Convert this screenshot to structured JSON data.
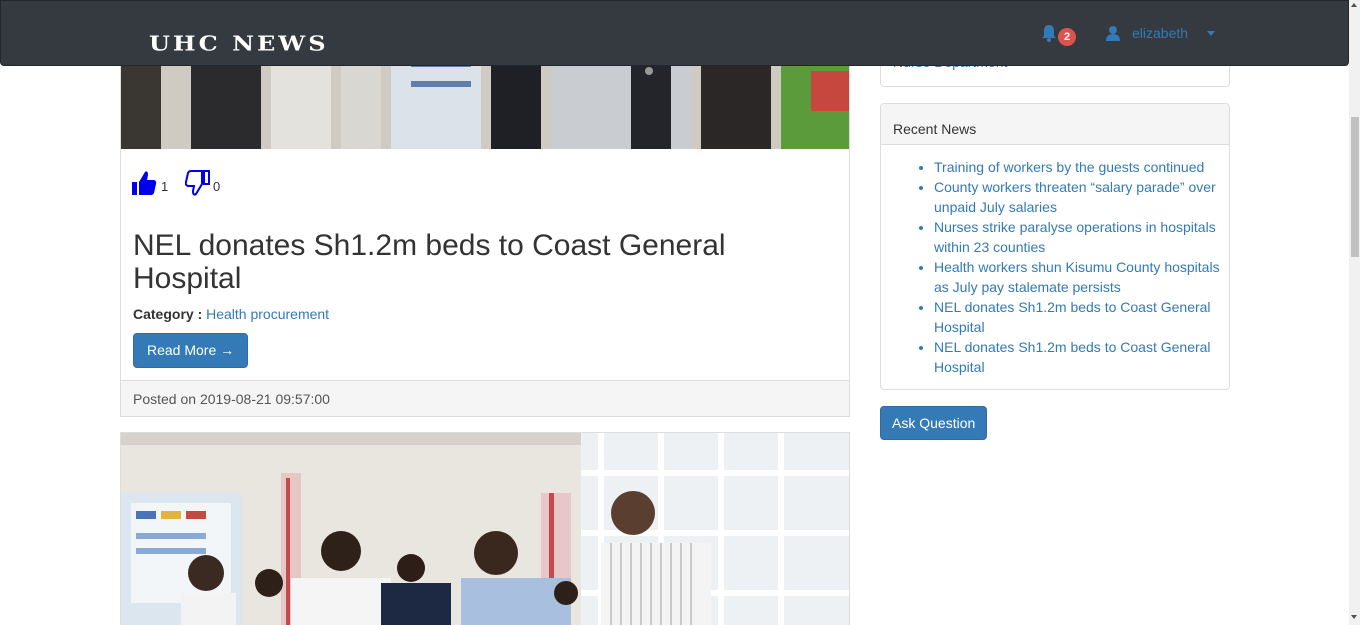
{
  "navbar": {
    "brand": "UHC NEWS",
    "notification_count": "2",
    "username": "elizabeth"
  },
  "posts": [
    {
      "likes": "1",
      "dislikes": "0",
      "title": "NEL donates Sh1.2m beds to Coast General Hospital",
      "category_label": "Category :",
      "category": "Health procurement",
      "read_more_label": "Read More →",
      "posted_on": "Posted on 2019-08-21 09:57:00"
    }
  ],
  "sidebar": {
    "department_link": "Nurse Department",
    "recent_news_title": "Recent News",
    "recent_news": [
      "Training of workers by the guests continued",
      "County workers threaten “salary parade” over unpaid July salaries",
      "Nurses strike paralyse operations in hospitals within 23 counties",
      "Health workers shun Kisumu County hospitals as July pay stalemate persists",
      "NEL donates Sh1.2m beds to Coast General Hospital",
      "NEL donates Sh1.2m beds to Coast General Hospital"
    ],
    "ask_question_label": "Ask Question"
  },
  "colors": {
    "navbar_bg": "#343a40",
    "link": "#337ab7",
    "primary_button": "#337ab7",
    "badge": "#d9534f",
    "thumb": "#0000ee"
  }
}
